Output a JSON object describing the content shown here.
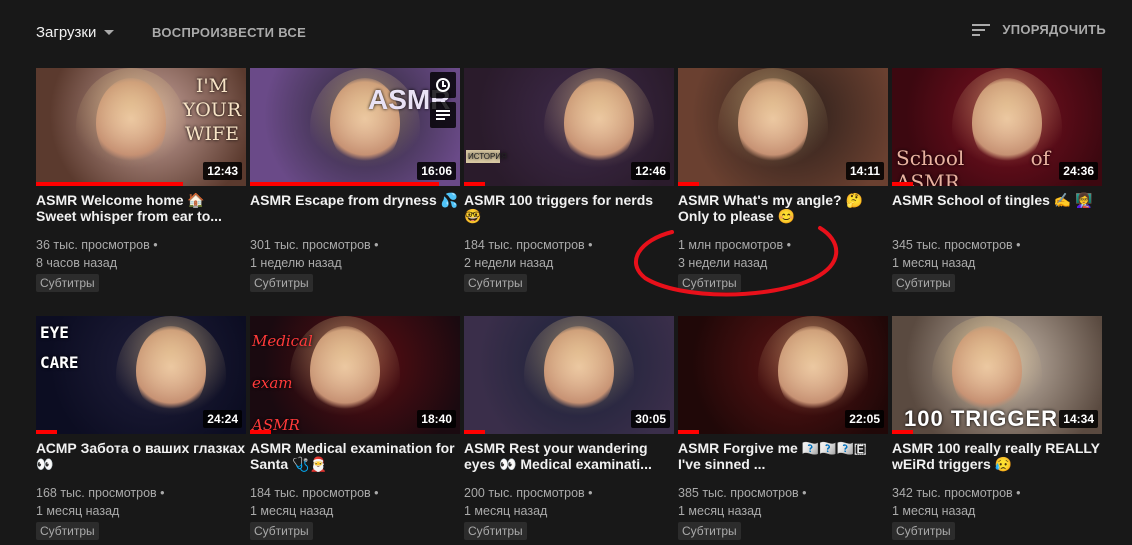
{
  "header": {
    "sort_label": "Загрузки",
    "play_all": "ВОСПРОИЗВЕСТИ ВСЕ",
    "order_label": "УПОРЯДОЧИТЬ"
  },
  "subtitles_badge": "Субтитры",
  "videos": [
    {
      "title": "ASMR Welcome home 🏠 Sweet whisper from ear to...",
      "views": "36 тыс. просмотров •",
      "age": "8 часов назад",
      "duration": "12:43",
      "progress": 0.7,
      "thumb_text": "I'M YOUR WIFE",
      "badge": true
    },
    {
      "title": "ASMR Escape from dryness 💦",
      "views": "301 тыс. просмотров •",
      "age": "1 неделю назад",
      "duration": "16:06",
      "progress": 0.9,
      "thumb_text": "ASMR",
      "badge": true
    },
    {
      "title": "ASMR 100 triggers for nerds 🤓",
      "views": "184 тыс. просмотров •",
      "age": "2 недели назад",
      "duration": "12:46",
      "progress": 0.1,
      "thumb_text": "ИСТОРИЯ",
      "badge": true
    },
    {
      "title": "ASMR What's my angle? 🤔 Only to please 😊",
      "views": "1 млн просмотров •",
      "age": "3 недели назад",
      "duration": "14:11",
      "progress": 0.1,
      "thumb_text": "",
      "badge": true
    },
    {
      "title": "ASMR School of tingles ✍️ 👩‍🏫",
      "views": "345 тыс. просмотров •",
      "age": "1 месяц назад",
      "duration": "24:36",
      "progress": 0.1,
      "thumb_text": "School of ASMR",
      "badge": true
    },
    {
      "title": "АСМР Забота о ваших глазках 👀",
      "views": "168 тыс. просмотров •",
      "age": "1 месяц назад",
      "duration": "24:24",
      "progress": 0.1,
      "thumb_text": "EYE CARE",
      "badge": false
    },
    {
      "title": "ASMR Medical examination for Santa 🩺🎅",
      "views": "184 тыс. просмотров •",
      "age": "1 месяц назад",
      "duration": "18:40",
      "progress": 0.1,
      "thumb_text": "Medical exam ASMR",
      "badge": true
    },
    {
      "title": "ASMR Rest your wandering eyes 👀 Medical examinati...",
      "views": "200 тыс. просмотров •",
      "age": "1 месяц назад",
      "duration": "30:05",
      "progress": 0.1,
      "thumb_text": "",
      "badge": true
    },
    {
      "title": "ASMR Forgive me 🇾🇴🇺🇹🇺🇧🇪 I've sinned ...",
      "views": "385 тыс. просмотров •",
      "age": "1 месяц назад",
      "duration": "22:05",
      "progress": 0.1,
      "thumb_text": "",
      "badge": false
    },
    {
      "title": "ASMR 100 really really REALLY wEiRd triggers 😥",
      "views": "342 тыс. просмотров •",
      "age": "1 месяц назад",
      "duration": "14:34",
      "progress": 0.1,
      "thumb_text": "100 TRIGGER",
      "badge": false
    }
  ]
}
